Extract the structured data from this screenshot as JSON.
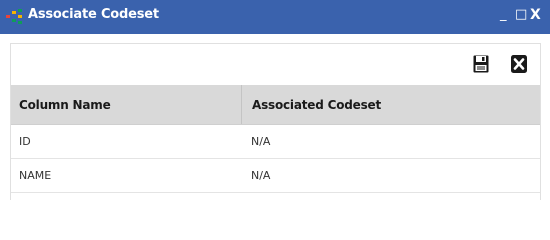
{
  "window": {
    "title": "Associate Codeset",
    "minimize_label": "_",
    "maximize_label": "□",
    "close_label": "X"
  },
  "toolbar": {
    "save_icon": "floppy-disk-icon",
    "cancel_icon": "close-box-icon"
  },
  "table": {
    "columns": [
      "Column Name",
      "Associated Codeset"
    ],
    "rows": [
      [
        "ID",
        "N/A"
      ],
      [
        "NAME",
        "N/A"
      ]
    ]
  },
  "colors": {
    "titlebar": "#3a62ad",
    "header_bg": "#d9d9d9"
  }
}
